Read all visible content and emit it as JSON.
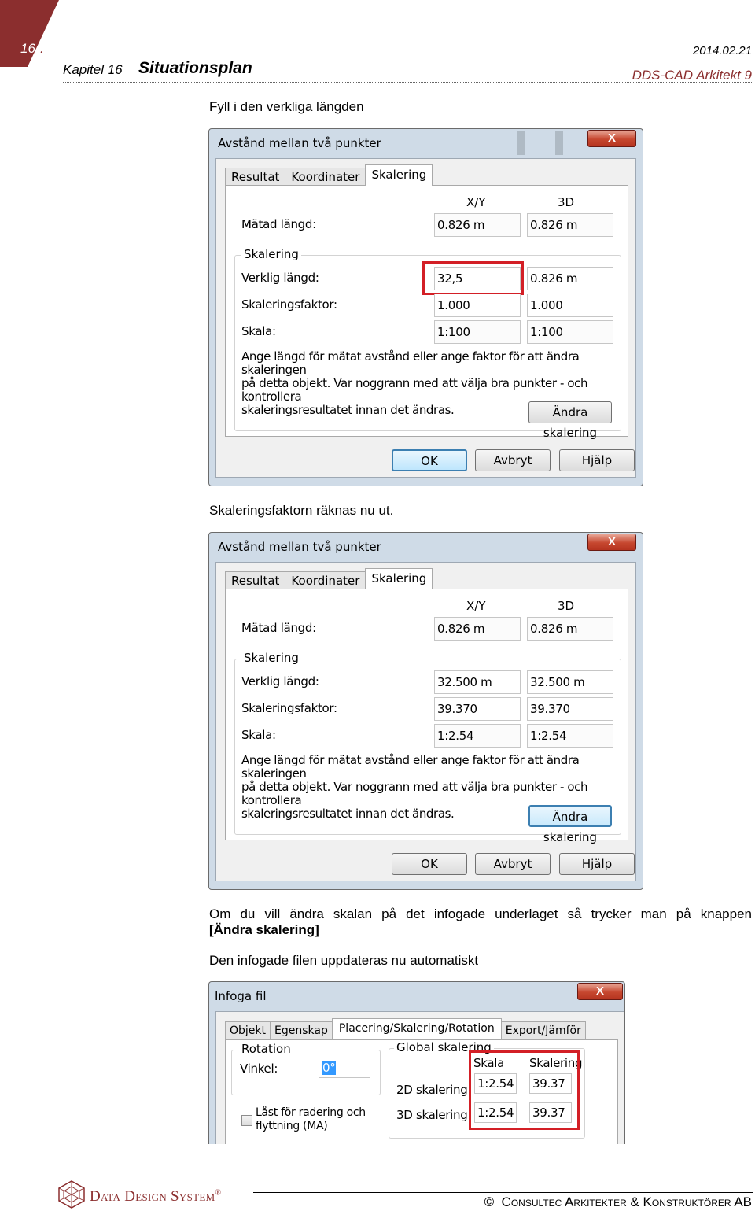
{
  "header": {
    "page_number": "16",
    "chapter_label": "Kapitel 16",
    "chapter_title": "Situationsplan",
    "date": "2014.02.21",
    "product": "DDS-CAD Arkitekt 9"
  },
  "text": {
    "intro": "Fyll i den verkliga längden",
    "after_first": "Skaleringsfaktorn räknas nu ut.",
    "change_scale_line1": "Om du vill ändra skalan på det infogade underlaget så trycker man på knappen",
    "change_scale_line2": "[Ändra skalering]",
    "auto_update": "Den infogade filen uppdateras nu automatiskt"
  },
  "dialog_common": {
    "title": "Avstånd mellan två punkter",
    "close": "X",
    "tabs": [
      "Resultat",
      "Koordinater",
      "Skalering"
    ],
    "col_xy": "X/Y",
    "col_3d": "3D",
    "measured_label": "Mätad längd:",
    "group_label": "Skalering",
    "real_label": "Verklig längd:",
    "factor_label": "Skaleringsfaktor:",
    "scale_label": "Skala:",
    "help_line1": "Ange längd för mätat avstånd eller ange faktor för att ändra skaleringen",
    "help_line2": "på detta objekt. Var noggrann med att välja  bra punkter - och kontrollera",
    "help_line3": "skaleringsresultatet innan det ändras.",
    "change_button": "Ändra skalering",
    "ok": "OK",
    "cancel": "Avbryt",
    "help": "Hjälp"
  },
  "dialog1": {
    "measured_xy": "0.826 m",
    "measured_3d": "0.826 m",
    "real_xy": "32,5",
    "real_3d": "0.826 m",
    "factor_xy": "1.000",
    "factor_3d": "1.000",
    "scale_xy": "1:100",
    "scale_3d": "1:100"
  },
  "dialog2": {
    "measured_xy": "0.826 m",
    "measured_3d": "0.826 m",
    "real_xy": "32.500 m",
    "real_3d": "32.500 m",
    "factor_xy": "39.370",
    "factor_3d": "39.370",
    "scale_xy": "1:2.54",
    "scale_3d": "1:2.54"
  },
  "dialog3": {
    "title": "Infoga fil",
    "close": "X",
    "tabs": [
      "Objekt",
      "Egenskap",
      "Placering/Skalering/Rotation",
      "Export/Jämför"
    ],
    "rotation_group": "Rotation",
    "angle_label": "Vinkel:",
    "angle_value": "0°",
    "lock_line1": "Låst för radering och",
    "lock_line2": "flyttning (MA)",
    "global_group": "Global skalering",
    "col_scale": "Skala",
    "col_scaling": "Skalering",
    "row_2d": "2D skalering:",
    "row_3d": "3D skalering:",
    "scale_2d": "1:2.54",
    "scaling_2d": "39.37",
    "scale_3d": "1:2.54",
    "scaling_3d": "39.37"
  },
  "footer": {
    "brand": "Data Design System",
    "registered": "®",
    "copyright_symbol": "©",
    "company": "Consultec Arkitekter & Konstruktörer AB"
  },
  "colors": {
    "accent_red": "#8b2e2e",
    "highlight_box": "#d31f26",
    "dialog_frame": "#cfdbe7"
  }
}
